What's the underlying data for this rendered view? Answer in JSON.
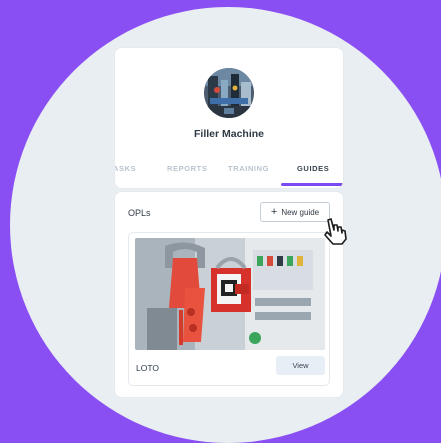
{
  "colors": {
    "background": "#8a4ff2",
    "circle": "#e9eef3",
    "accent": "#7b4af0"
  },
  "machine": {
    "title": "Filler Machine",
    "avatar_icon": "machine-photo"
  },
  "tabs": [
    {
      "label": "ASKS",
      "active": false
    },
    {
      "label": "REPORTS",
      "active": false
    },
    {
      "label": "TRAINING",
      "active": false
    },
    {
      "label": "GUIDES",
      "active": true
    }
  ],
  "opls": {
    "section_title": "OPLs",
    "new_button_label": "New guide",
    "new_button_icon": "plus-icon",
    "items": [
      {
        "label": "LOTO",
        "view_label": "View",
        "image_icon": "lockout-tagout-photo"
      }
    ]
  },
  "cursor_icon": "hand-pointer-icon"
}
